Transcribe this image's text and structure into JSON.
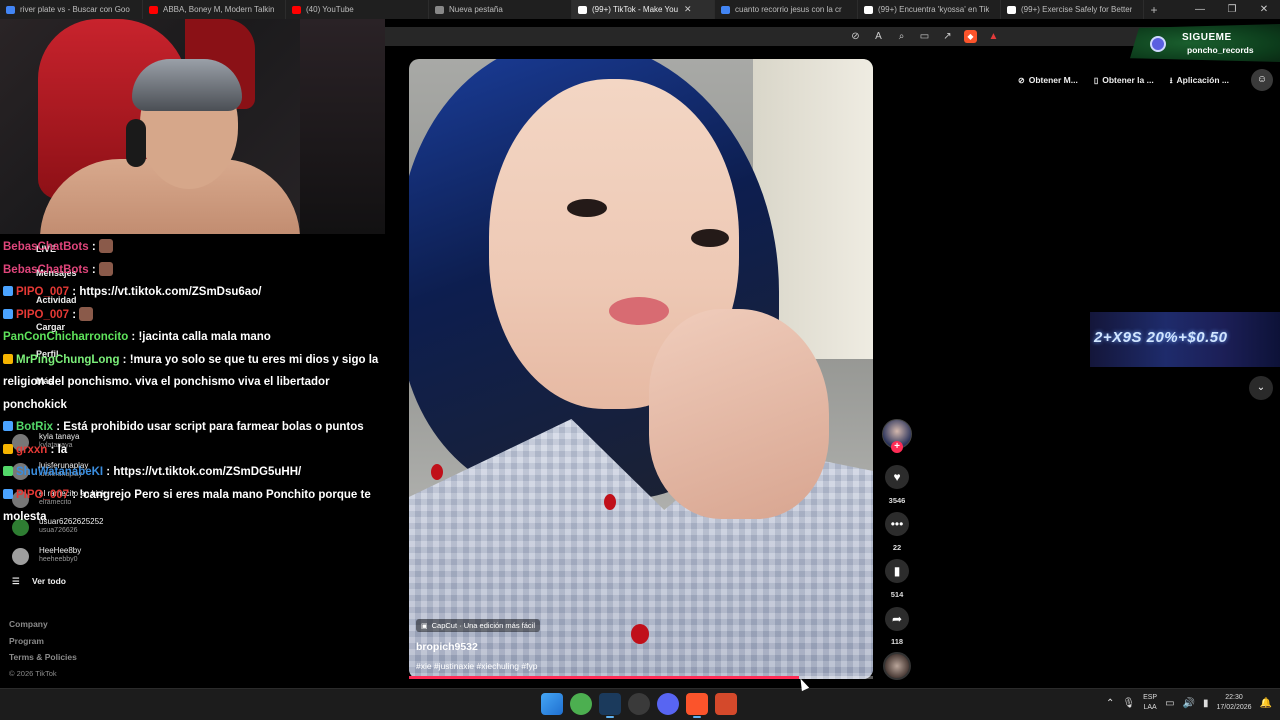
{
  "browser": {
    "tabs": [
      {
        "label": "river plate vs - Buscar con Goo",
        "color": "#4285f4"
      },
      {
        "label": "ABBA, Boney M, Modern Talkin",
        "color": "#ff0000"
      },
      {
        "label": "(40) YouTube",
        "color": "#ff0000"
      },
      {
        "label": "Nueva pestaña",
        "color": "#888888"
      },
      {
        "label": "(99+) TikTok - Make You",
        "color": "#ffffff",
        "active": true
      },
      {
        "label": "cuanto recorrio jesus con la cr",
        "color": "#4285f4"
      },
      {
        "label": "(99+) Encuentra 'kyossa' en Tik",
        "color": "#ffffff"
      },
      {
        "label": "(99+) Exercise Safely for Better",
        "color": "#ffffff"
      }
    ],
    "new_tab": "+",
    "window_controls": [
      "—",
      "❐",
      "✕"
    ],
    "tab_close": "✕"
  },
  "overlay": {
    "follow_title": "SIGUEME",
    "follow_user": "poncho_records"
  },
  "chat": [
    {
      "user": "BebasChatBots",
      "sep": " :",
      "text": "",
      "color": "#e0457b",
      "badge": "",
      "emote": true
    },
    {
      "user": "BebasChatBots",
      "sep": " :",
      "text": "",
      "color": "#e0457b",
      "badge": "",
      "emote": true
    },
    {
      "user": "PIPO_007",
      "sep": " : ",
      "text": "https://vt.tiktok.com/ZSmDsu6ao/",
      "color": "#e53935",
      "badge": "#4aa3ff",
      "emote": false
    },
    {
      "user": "PIPO_007",
      "sep": " :",
      "text": "",
      "color": "#e53935",
      "badge": "#4aa3ff",
      "emote": true
    },
    {
      "user": "PanConChicharroncito",
      "sep": " : ",
      "text": "!jacinta calla mala mano",
      "color": "#5ee35b",
      "badge": "",
      "emote": false
    },
    {
      "user": "MrPingChungLong",
      "sep": " : ",
      "text": "!mura yo solo se que tu eres mi dios y sigo la religion del ponchismo. viva el ponchismo viva el libertador ponchokick",
      "color": "#7cf07a",
      "badge": "#f5b400",
      "emote": false
    },
    {
      "user": "BotRix",
      "sep": " : ",
      "text": "Está prohibido usar script para farmear bolas o puntos",
      "color": "#53d769",
      "badge": "#4aa3ff",
      "emote": false
    },
    {
      "user": "grxxn",
      "sep": " : ",
      "text": "la",
      "color": "#e53935",
      "badge": "#f5b400",
      "emote": false
    },
    {
      "user": "ShuWatanabeKI",
      "sep": " : ",
      "text": "https://vt.tiktok.com/ZSmDG5uHH/",
      "color": "#3a8dde",
      "badge": "#53d769",
      "emote": false
    },
    {
      "user": "PIPO_007",
      "sep": " : ",
      "text": "!cangrejo Pero si eres mala mano Ponchito porque te molesta",
      "color": "#e53935",
      "badge": "#4aa3ff",
      "emote": false
    }
  ],
  "sidebar": {
    "items": [
      "LIVE",
      "Mensajes",
      "Actividad",
      "Cargar",
      "Perfil",
      "Más"
    ],
    "following": [
      {
        "name": "kyla tanaya",
        "handle": "kylatanaya"
      },
      {
        "name": "luisferunaplay",
        "handle": "luisferunaplay"
      },
      {
        "name": "el ramecito en kick",
        "handle": "elramecito"
      },
      {
        "name": "usuar6262625252",
        "handle": "usua726626"
      },
      {
        "name": "HeeHee8by",
        "handle": "heeheebby0"
      }
    ],
    "see_all": "Ver todo",
    "footer": [
      "Company",
      "Program",
      "Terms & Policies"
    ],
    "copyright": "© 2026 TikTok"
  },
  "video": {
    "capcut_label": "CapCut · Una edición más fácil",
    "username": "bropich9532",
    "hashtags": "#xie #justinaxie #xiechuling #fyp",
    "progress": 0.84,
    "likes": "3546",
    "comments": "22",
    "saves": "514",
    "shares": "118"
  },
  "right_tools": [
    {
      "icon": "⊘",
      "label": "Obtener M..."
    },
    {
      "icon": "▯",
      "label": "Obtener la ..."
    },
    {
      "icon": "⭳",
      "label": "Aplicación ..."
    }
  ],
  "banner": {
    "small": "promo",
    "text": "2+X9S 20%+$0.50"
  },
  "taskbar": {
    "apps": [
      {
        "name": "windows-start",
        "color": "#2f8cf0"
      },
      {
        "name": "chrome",
        "color": "#4caf50"
      },
      {
        "name": "steam",
        "color": "#1b3a5c"
      },
      {
        "name": "settings",
        "color": "#3a3a3a"
      },
      {
        "name": "discord",
        "color": "#5865f2"
      },
      {
        "name": "brave",
        "color": "#fb542b"
      },
      {
        "name": "app-4",
        "color": "#d4492b"
      }
    ],
    "lang_top": "ESP",
    "lang_bottom": "LAA",
    "time": "22:30",
    "date": "17/02/2026"
  }
}
